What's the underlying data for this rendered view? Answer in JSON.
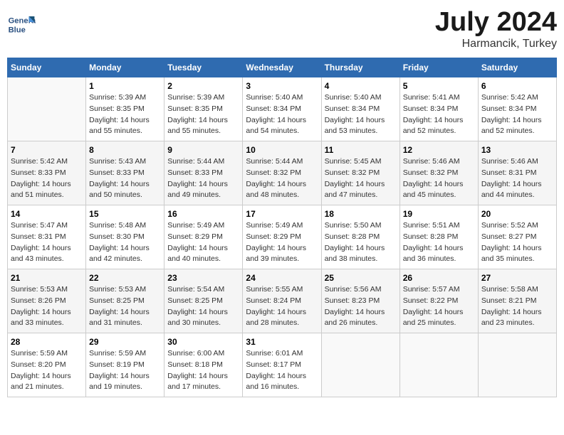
{
  "header": {
    "logo_line1": "General",
    "logo_line2": "Blue",
    "title": "July 2024",
    "subtitle": "Harmancik, Turkey"
  },
  "calendar": {
    "columns": [
      "Sunday",
      "Monday",
      "Tuesday",
      "Wednesday",
      "Thursday",
      "Friday",
      "Saturday"
    ],
    "rows": [
      [
        {
          "day": "",
          "sunrise": "",
          "sunset": "",
          "daylight": ""
        },
        {
          "day": "1",
          "sunrise": "Sunrise: 5:39 AM",
          "sunset": "Sunset: 8:35 PM",
          "daylight": "Daylight: 14 hours and 55 minutes."
        },
        {
          "day": "2",
          "sunrise": "Sunrise: 5:39 AM",
          "sunset": "Sunset: 8:35 PM",
          "daylight": "Daylight: 14 hours and 55 minutes."
        },
        {
          "day": "3",
          "sunrise": "Sunrise: 5:40 AM",
          "sunset": "Sunset: 8:34 PM",
          "daylight": "Daylight: 14 hours and 54 minutes."
        },
        {
          "day": "4",
          "sunrise": "Sunrise: 5:40 AM",
          "sunset": "Sunset: 8:34 PM",
          "daylight": "Daylight: 14 hours and 53 minutes."
        },
        {
          "day": "5",
          "sunrise": "Sunrise: 5:41 AM",
          "sunset": "Sunset: 8:34 PM",
          "daylight": "Daylight: 14 hours and 52 minutes."
        },
        {
          "day": "6",
          "sunrise": "Sunrise: 5:42 AM",
          "sunset": "Sunset: 8:34 PM",
          "daylight": "Daylight: 14 hours and 52 minutes."
        }
      ],
      [
        {
          "day": "7",
          "sunrise": "Sunrise: 5:42 AM",
          "sunset": "Sunset: 8:33 PM",
          "daylight": "Daylight: 14 hours and 51 minutes."
        },
        {
          "day": "8",
          "sunrise": "Sunrise: 5:43 AM",
          "sunset": "Sunset: 8:33 PM",
          "daylight": "Daylight: 14 hours and 50 minutes."
        },
        {
          "day": "9",
          "sunrise": "Sunrise: 5:44 AM",
          "sunset": "Sunset: 8:33 PM",
          "daylight": "Daylight: 14 hours and 49 minutes."
        },
        {
          "day": "10",
          "sunrise": "Sunrise: 5:44 AM",
          "sunset": "Sunset: 8:32 PM",
          "daylight": "Daylight: 14 hours and 48 minutes."
        },
        {
          "day": "11",
          "sunrise": "Sunrise: 5:45 AM",
          "sunset": "Sunset: 8:32 PM",
          "daylight": "Daylight: 14 hours and 47 minutes."
        },
        {
          "day": "12",
          "sunrise": "Sunrise: 5:46 AM",
          "sunset": "Sunset: 8:32 PM",
          "daylight": "Daylight: 14 hours and 45 minutes."
        },
        {
          "day": "13",
          "sunrise": "Sunrise: 5:46 AM",
          "sunset": "Sunset: 8:31 PM",
          "daylight": "Daylight: 14 hours and 44 minutes."
        }
      ],
      [
        {
          "day": "14",
          "sunrise": "Sunrise: 5:47 AM",
          "sunset": "Sunset: 8:31 PM",
          "daylight": "Daylight: 14 hours and 43 minutes."
        },
        {
          "day": "15",
          "sunrise": "Sunrise: 5:48 AM",
          "sunset": "Sunset: 8:30 PM",
          "daylight": "Daylight: 14 hours and 42 minutes."
        },
        {
          "day": "16",
          "sunrise": "Sunrise: 5:49 AM",
          "sunset": "Sunset: 8:29 PM",
          "daylight": "Daylight: 14 hours and 40 minutes."
        },
        {
          "day": "17",
          "sunrise": "Sunrise: 5:49 AM",
          "sunset": "Sunset: 8:29 PM",
          "daylight": "Daylight: 14 hours and 39 minutes."
        },
        {
          "day": "18",
          "sunrise": "Sunrise: 5:50 AM",
          "sunset": "Sunset: 8:28 PM",
          "daylight": "Daylight: 14 hours and 38 minutes."
        },
        {
          "day": "19",
          "sunrise": "Sunrise: 5:51 AM",
          "sunset": "Sunset: 8:28 PM",
          "daylight": "Daylight: 14 hours and 36 minutes."
        },
        {
          "day": "20",
          "sunrise": "Sunrise: 5:52 AM",
          "sunset": "Sunset: 8:27 PM",
          "daylight": "Daylight: 14 hours and 35 minutes."
        }
      ],
      [
        {
          "day": "21",
          "sunrise": "Sunrise: 5:53 AM",
          "sunset": "Sunset: 8:26 PM",
          "daylight": "Daylight: 14 hours and 33 minutes."
        },
        {
          "day": "22",
          "sunrise": "Sunrise: 5:53 AM",
          "sunset": "Sunset: 8:25 PM",
          "daylight": "Daylight: 14 hours and 31 minutes."
        },
        {
          "day": "23",
          "sunrise": "Sunrise: 5:54 AM",
          "sunset": "Sunset: 8:25 PM",
          "daylight": "Daylight: 14 hours and 30 minutes."
        },
        {
          "day": "24",
          "sunrise": "Sunrise: 5:55 AM",
          "sunset": "Sunset: 8:24 PM",
          "daylight": "Daylight: 14 hours and 28 minutes."
        },
        {
          "day": "25",
          "sunrise": "Sunrise: 5:56 AM",
          "sunset": "Sunset: 8:23 PM",
          "daylight": "Daylight: 14 hours and 26 minutes."
        },
        {
          "day": "26",
          "sunrise": "Sunrise: 5:57 AM",
          "sunset": "Sunset: 8:22 PM",
          "daylight": "Daylight: 14 hours and 25 minutes."
        },
        {
          "day": "27",
          "sunrise": "Sunrise: 5:58 AM",
          "sunset": "Sunset: 8:21 PM",
          "daylight": "Daylight: 14 hours and 23 minutes."
        }
      ],
      [
        {
          "day": "28",
          "sunrise": "Sunrise: 5:59 AM",
          "sunset": "Sunset: 8:20 PM",
          "daylight": "Daylight: 14 hours and 21 minutes."
        },
        {
          "day": "29",
          "sunrise": "Sunrise: 5:59 AM",
          "sunset": "Sunset: 8:19 PM",
          "daylight": "Daylight: 14 hours and 19 minutes."
        },
        {
          "day": "30",
          "sunrise": "Sunrise: 6:00 AM",
          "sunset": "Sunset: 8:18 PM",
          "daylight": "Daylight: 14 hours and 17 minutes."
        },
        {
          "day": "31",
          "sunrise": "Sunrise: 6:01 AM",
          "sunset": "Sunset: 8:17 PM",
          "daylight": "Daylight: 14 hours and 16 minutes."
        },
        {
          "day": "",
          "sunrise": "",
          "sunset": "",
          "daylight": ""
        },
        {
          "day": "",
          "sunrise": "",
          "sunset": "",
          "daylight": ""
        },
        {
          "day": "",
          "sunrise": "",
          "sunset": "",
          "daylight": ""
        }
      ]
    ]
  }
}
